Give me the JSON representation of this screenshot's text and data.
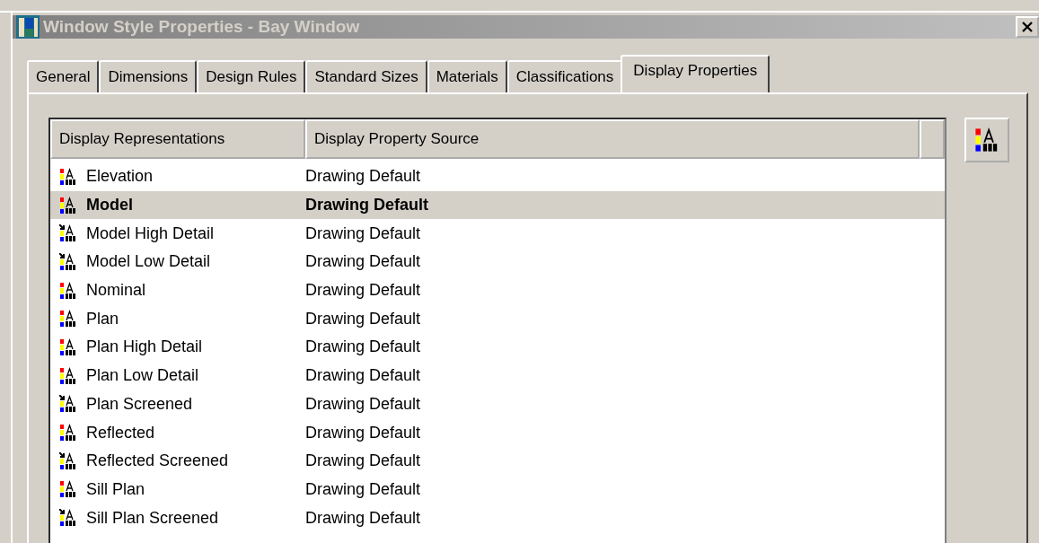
{
  "window": {
    "title": "Window Style Properties - Bay Window"
  },
  "tabs": [
    {
      "label": "General",
      "selected": false
    },
    {
      "label": "Dimensions",
      "selected": false
    },
    {
      "label": "Design Rules",
      "selected": false
    },
    {
      "label": "Standard Sizes",
      "selected": false
    },
    {
      "label": "Materials",
      "selected": false
    },
    {
      "label": "Classifications",
      "selected": false
    },
    {
      "label": "Display Properties",
      "selected": true
    }
  ],
  "table": {
    "columns": [
      "Display Representations",
      "Display Property Source"
    ],
    "rows": [
      {
        "kind": "plain",
        "name": "Elevation",
        "source": "Drawing Default",
        "selected": false
      },
      {
        "kind": "plain",
        "name": "Model",
        "source": "Drawing Default",
        "selected": true
      },
      {
        "kind": "arrow",
        "name": "Model High Detail",
        "source": "Drawing Default",
        "selected": false
      },
      {
        "kind": "arrow",
        "name": "Model Low Detail",
        "source": "Drawing Default",
        "selected": false
      },
      {
        "kind": "plain",
        "name": "Nominal",
        "source": "Drawing Default",
        "selected": false
      },
      {
        "kind": "plain",
        "name": "Plan",
        "source": "Drawing Default",
        "selected": false
      },
      {
        "kind": "plain",
        "name": "Plan High Detail",
        "source": "Drawing Default",
        "selected": false
      },
      {
        "kind": "plain",
        "name": "Plan Low Detail",
        "source": "Drawing Default",
        "selected": false
      },
      {
        "kind": "arrow",
        "name": "Plan Screened",
        "source": "Drawing Default",
        "selected": false
      },
      {
        "kind": "plain",
        "name": "Reflected",
        "source": "Drawing Default",
        "selected": false
      },
      {
        "kind": "arrow",
        "name": "Reflected Screened",
        "source": "Drawing Default",
        "selected": false
      },
      {
        "kind": "plain",
        "name": "Sill Plan",
        "source": "Drawing Default",
        "selected": false
      },
      {
        "kind": "arrow",
        "name": "Sill Plan Screened",
        "source": "Drawing Default",
        "selected": false
      }
    ]
  }
}
